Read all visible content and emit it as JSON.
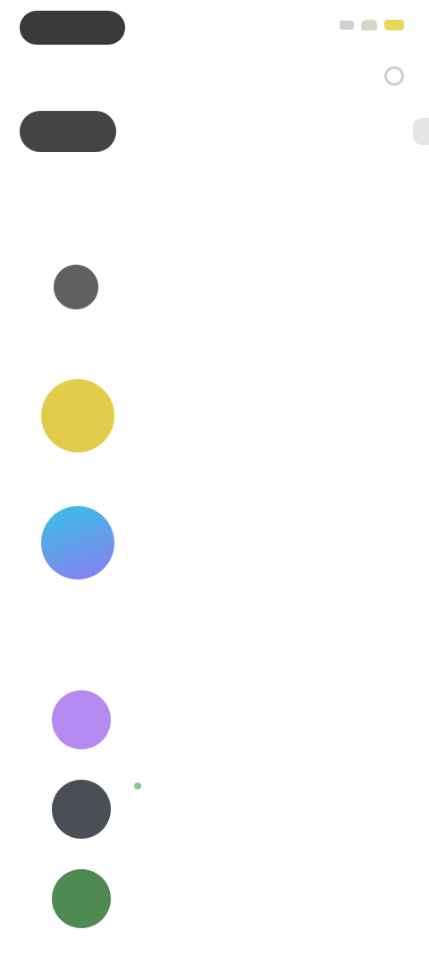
{
  "status_bar": {
    "pill": "",
    "icons": [
      "signal-icon",
      "wifi-icon",
      "battery-icon"
    ],
    "colors": {
      "pill": "#3a3a3a",
      "battery": "#e7d85a"
    }
  },
  "header": {
    "title": "",
    "action_icon": "search-icon"
  },
  "chips": [
    {
      "label": "",
      "active": true
    },
    {
      "label": "",
      "active": false
    },
    {
      "label": "",
      "active": false
    }
  ],
  "sections": [
    {
      "title": "",
      "subtitle": "",
      "items": [
        {
          "title": "",
          "description": "",
          "meta": "",
          "avatar_icon": "app-avatar",
          "avatar_color": "#606060"
        },
        {
          "title": "",
          "description": "",
          "meta": "",
          "avatar_icon": "app-avatar",
          "avatar_color": "#e2cc4a"
        },
        {
          "title": "",
          "description": "",
          "meta": "",
          "avatar_icon": "app-avatar",
          "avatar_color": "#4aa8e6"
        }
      ]
    },
    {
      "title": "",
      "subtitle": "",
      "items": [
        {
          "title": "",
          "description": "",
          "meta": "",
          "avatar_icon": "app-avatar",
          "avatar_color": "#b58af0"
        },
        {
          "title": "",
          "description": "",
          "meta": "",
          "avatar_icon": "app-avatar",
          "avatar_color": "#4a4f55"
        },
        {
          "title": "",
          "description": "",
          "meta": "",
          "avatar_icon": "app-avatar",
          "avatar_color": "#4e8a52"
        }
      ]
    }
  ],
  "colors": {
    "accent_text": "#6a6a6a",
    "muted_text": "#a6a6a6",
    "background": "#ffffff"
  }
}
